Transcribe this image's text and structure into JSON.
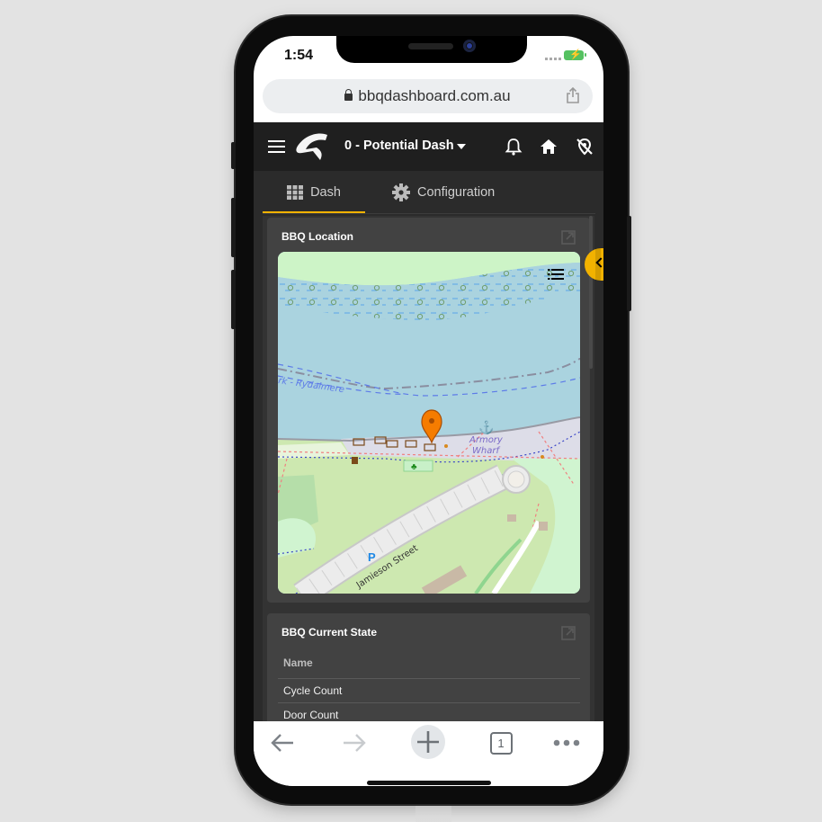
{
  "status_bar": {
    "time": "1:54",
    "battery_icon": "battery-charging-icon"
  },
  "browser": {
    "url": "bbqdashboard.com.au",
    "lock_icon": "lock-icon",
    "share_icon": "share-icon",
    "toolbar": {
      "back_icon": "arrow-left-icon",
      "forward_icon": "arrow-right-icon",
      "new_tab_icon": "plus-icon",
      "tab_count": "1",
      "more_icon": "more-dots-icon"
    }
  },
  "app": {
    "menu_icon": "hamburger-icon",
    "logo": "brand-logo",
    "dashboard_selector": "0 - Potential Dash",
    "header_icons": [
      "bell-icon",
      "home-icon",
      "no-location-icon"
    ],
    "accent_color": "#f2b200",
    "tabs": [
      {
        "label": "Dash",
        "icon": "grid-icon",
        "active": true
      },
      {
        "label": "Configuration",
        "icon": "gear-icon",
        "active": false
      }
    ]
  },
  "cards": [
    {
      "title": "BBQ Location",
      "type": "map",
      "map": {
        "labels": [
          "rk - Rydalmere",
          "Armory Wharf",
          "Jamieson Street"
        ],
        "marker_color": "#f57c00",
        "layers_icon": "list-icon"
      }
    },
    {
      "title": "BBQ Current State",
      "type": "table",
      "columns": [
        "Name"
      ],
      "rows": [
        "Cycle Count",
        "Door Count"
      ]
    }
  ]
}
